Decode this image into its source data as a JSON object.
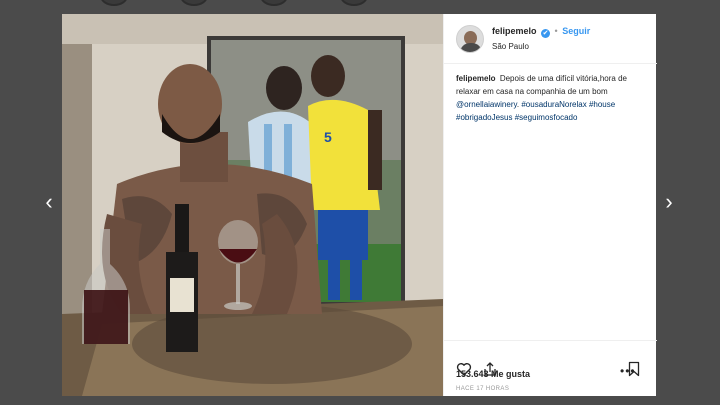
{
  "post": {
    "username": "felipemelo",
    "verified_badge": "✔",
    "separator": "•",
    "follow_label": "Seguir",
    "location": "São Paulo",
    "caption": {
      "username": "felipemelo",
      "text": "Depois de uma difícil vitória,hora de relaxar em casa na companhia de um bom",
      "mention": "@ornellaiawinery",
      "hashtags": [
        "#ousaduraNorelax",
        "#house",
        "#obrigadoJesus",
        "#seguimosfocado"
      ]
    },
    "likes": "153.643 Me gusta",
    "timestamp": "HACE 17 HORAS",
    "more_label": "•••"
  },
  "navigation": {
    "prev_label": "‹",
    "next_label": "›"
  },
  "icons": {
    "like": "heart-icon",
    "share": "share-icon",
    "save": "bookmark-icon",
    "more": "more-options-icon"
  },
  "colors": {
    "backdrop": "#4b4b4b",
    "link": "#3897f0",
    "hashtag": "#003569",
    "text": "#262626",
    "muted": "#999999"
  }
}
